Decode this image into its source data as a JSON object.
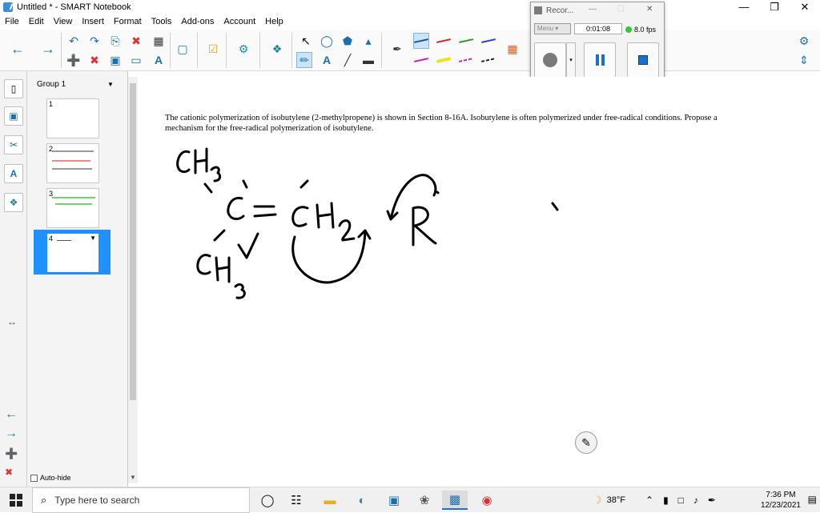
{
  "window": {
    "title": "Untitled * - SMART Notebook",
    "controls": [
      "—",
      "❐",
      "✕"
    ]
  },
  "menu": [
    "File",
    "Edit",
    "View",
    "Insert",
    "Format",
    "Tools",
    "Add-ons",
    "Account",
    "Help"
  ],
  "recorder": {
    "title": "Recor...",
    "menu_label": "Menu",
    "time": "0:01:08",
    "fps": "8.0 fps",
    "status_color": "#2ecc2e"
  },
  "pages": {
    "group_label": "Group 1",
    "thumbnails": [
      {
        "num": "1"
      },
      {
        "num": "2"
      },
      {
        "num": "3"
      },
      {
        "num": "4"
      }
    ],
    "selected_index": 3,
    "autohide_label": "Auto-hide"
  },
  "canvas": {
    "question": "The cationic polymerization of isobutylene (2-methylpropene) is shown in Section 8-16A. Isobutylene is often polymerized under free-radical conditions. Propose a mechanism for the free-radical polymerization of isobutylene."
  },
  "taskbar": {
    "search_placeholder": "Type here to search",
    "weather": "38°F",
    "time": "7:36 PM",
    "date": "12/23/2021"
  },
  "colors": {
    "accent": "#1e90ff",
    "selection": "#cce4f7",
    "toolbar_bg": "#fafafa"
  }
}
